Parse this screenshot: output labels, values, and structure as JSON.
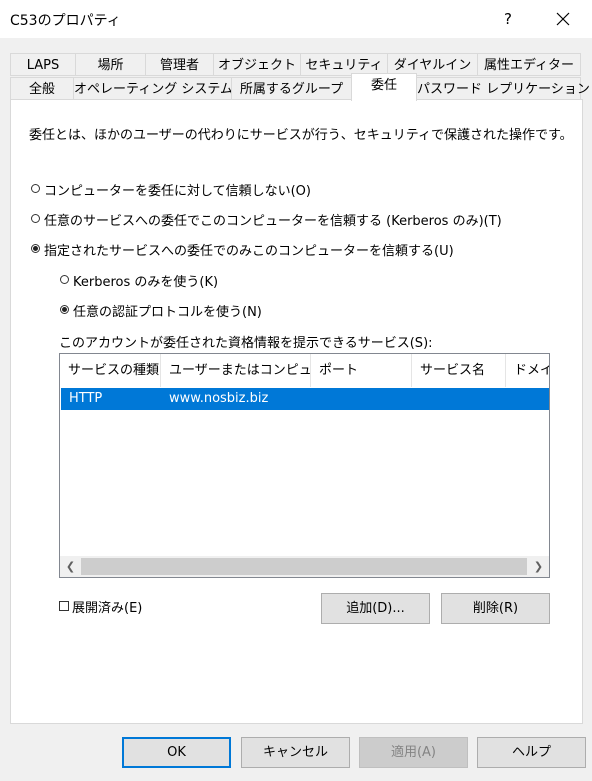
{
  "window": {
    "title": "C53のプロパティ",
    "help": "?"
  },
  "tabs_row1": [
    "LAPS",
    "場所",
    "管理者",
    "オブジェクト",
    "セキュリティ",
    "ダイヤルイン",
    "属性エディター"
  ],
  "tabs_row2": [
    "全般",
    "オペレーティング システム",
    "所属するグループ",
    "委任",
    "パスワード レプリケーション"
  ],
  "description": "委任とは、ほかのユーザーの代わりにサービスが行う、セキュリティで保護された操作です。",
  "options": {
    "no_trust": "コンピューターを委任に対して信頼しない(O)",
    "trust_any": "任意のサービスへの委任でこのコンピューターを信頼する (Kerberos のみ)(T)",
    "trust_specified": "指定されたサービスへの委任でのみこのコンピューターを信頼する(U)",
    "kerberos_only": "Kerberos のみを使う(K)",
    "any_protocol": "任意の認証プロトコルを使う(N)"
  },
  "services_label": "このアカウントが委任された資格情報を提示できるサービス(S):",
  "columns": [
    "サービスの種類",
    "ユーザーまたはコンピュ...",
    "ポート",
    "サービス名",
    "ドメイ"
  ],
  "rows": [
    {
      "type": "HTTP",
      "host": "www.nosbiz.biz"
    }
  ],
  "expanded_label": "展開済み(E)",
  "buttons": {
    "add": "追加(D)...",
    "remove": "削除(R)",
    "ok": "OK",
    "cancel": "キャンセル",
    "apply": "適用(A)",
    "help": "ヘルプ"
  }
}
